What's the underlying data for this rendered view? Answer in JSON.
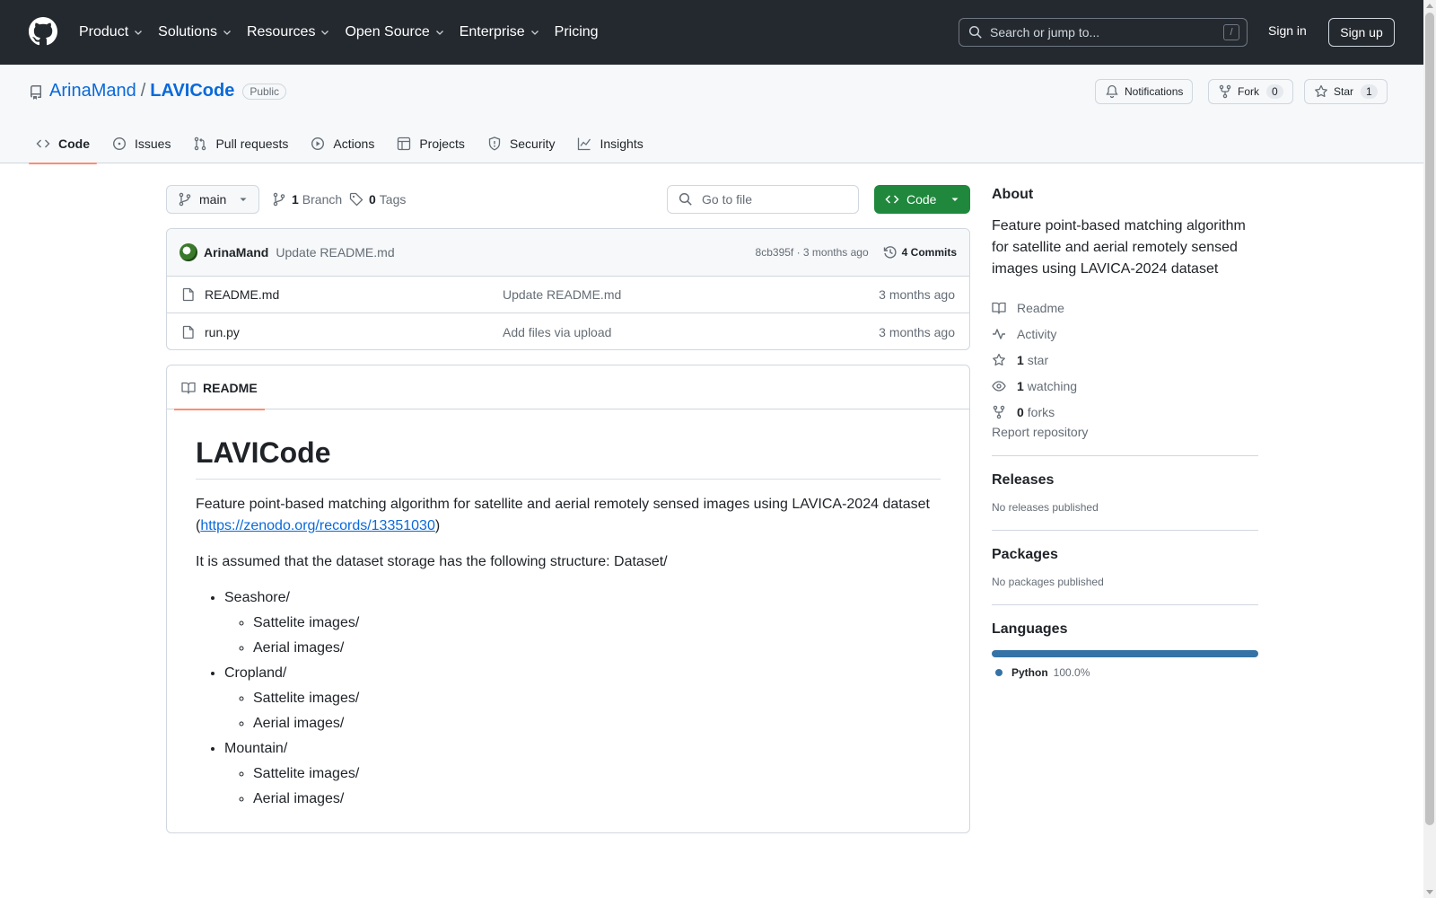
{
  "header": {
    "nav": [
      "Product",
      "Solutions",
      "Resources",
      "Open Source",
      "Enterprise",
      "Pricing"
    ],
    "search_placeholder": "Search or jump to...",
    "search_shortcut": "/",
    "signin": "Sign in",
    "signup": "Sign up"
  },
  "repo": {
    "owner": "ArinaMand",
    "separator": "/",
    "name": "LAVICode",
    "visibility": "Public",
    "notifications": "Notifications",
    "fork_label": "Fork",
    "fork_count": "0",
    "star_label": "Star",
    "star_count": "1"
  },
  "tabs": [
    "Code",
    "Issues",
    "Pull requests",
    "Actions",
    "Projects",
    "Security",
    "Insights"
  ],
  "toolbar": {
    "branch": "main",
    "branch_count": "1",
    "branch_label": "Branch",
    "tag_count": "0",
    "tag_label": "Tags",
    "goto_placeholder": "Go to file",
    "code_button": "Code"
  },
  "commit": {
    "author": "ArinaMand",
    "message": "Update README.md",
    "sha_time": "8cb395f · 3 months ago",
    "commits": "4 Commits"
  },
  "files": [
    {
      "name": "README.md",
      "message": "Update README.md",
      "date": "3 months ago"
    },
    {
      "name": "run.py",
      "message": "Add files via upload",
      "date": "3 months ago"
    }
  ],
  "readme": {
    "tab": "README",
    "title": "LAVICode",
    "intro": "Feature point-based matching algorithm for satellite and aerial remotely sensed images using LAVICA-2024 dataset",
    "paren_open": "(",
    "link": "https://zenodo.org/records/13351030",
    "paren_close": ")",
    "structure_text": "It is assumed that the dataset storage has the following structure: Dataset/",
    "tree": [
      {
        "name": "Seashore/",
        "children": [
          "Sattelite images/",
          "Aerial images/"
        ]
      },
      {
        "name": "Cropland/",
        "children": [
          "Sattelite images/",
          "Aerial images/"
        ]
      },
      {
        "name": "Mountain/",
        "children": [
          "Sattelite images/",
          "Aerial images/"
        ]
      }
    ]
  },
  "about": {
    "heading": "About",
    "description": "Feature point-based matching algorithm for satellite and aerial remotely sensed images using LAVICA-2024 dataset",
    "readme": "Readme",
    "activity": "Activity",
    "stars_count": "1",
    "stars_label": "star",
    "watching_count": "1",
    "watching_label": "watching",
    "forks_count": "0",
    "forks_label": "forks",
    "report": "Report repository"
  },
  "releases": {
    "heading": "Releases",
    "empty": "No releases published"
  },
  "packages": {
    "heading": "Packages",
    "empty": "No packages published"
  },
  "languages": {
    "heading": "Languages",
    "items": [
      {
        "name": "Python",
        "percent": "100.0%",
        "color": "#3572a5"
      }
    ]
  },
  "colors": {
    "header_bg": "#24292f",
    "accent": "#0969da",
    "code_button": "#1f883d",
    "active_tab": "#fd8c73"
  }
}
